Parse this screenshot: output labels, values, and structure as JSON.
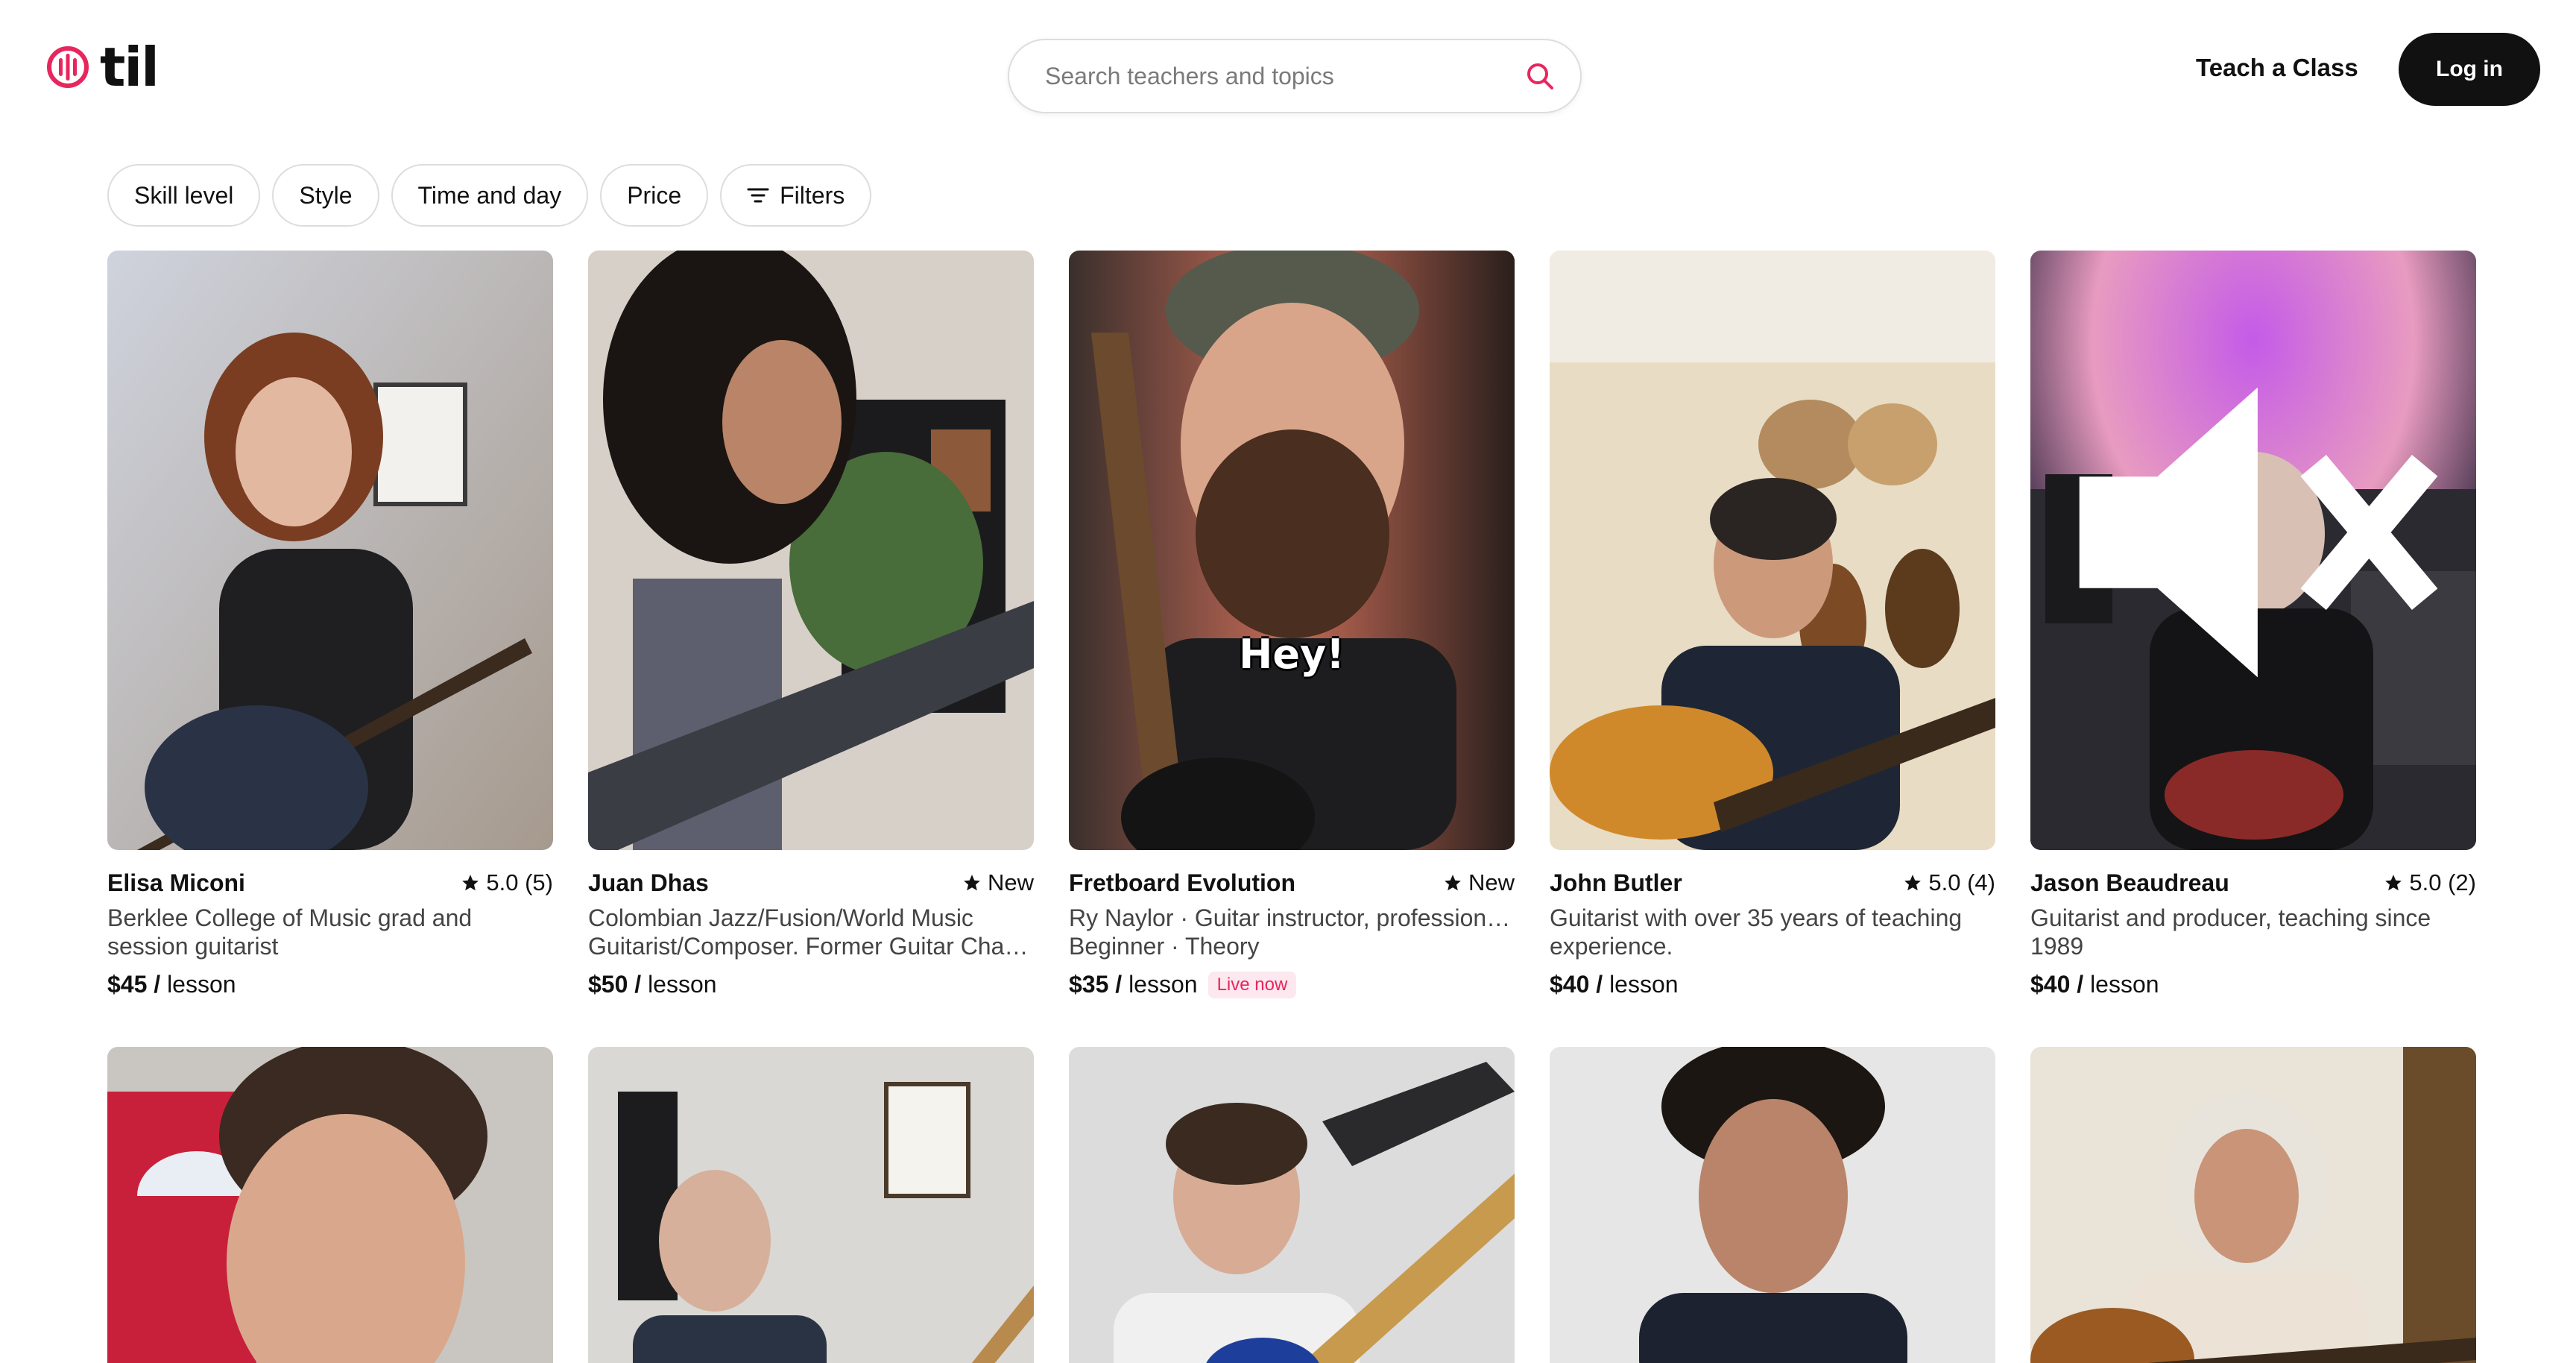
{
  "brand": {
    "name": "til",
    "accent": "#e8265e"
  },
  "search": {
    "placeholder": "Search teachers and topics",
    "icon": "search-icon"
  },
  "nav": {
    "teach_label": "Teach a Class",
    "login_label": "Log in"
  },
  "filters": [
    {
      "label": "Skill level"
    },
    {
      "label": "Style"
    },
    {
      "label": "Time and day"
    },
    {
      "label": "Price"
    },
    {
      "label": "Filters",
      "icon": "filters-icon"
    }
  ],
  "cards": [
    {
      "name": "Elisa Miconi",
      "rating": "5.0 (5)",
      "description": "Berklee College of Music grad and session guitarist",
      "price": "$45",
      "unit": "lesson"
    },
    {
      "name": "Juan Dhas",
      "rating": "New",
      "description": "Colombian Jazz/Fusion/World Music Guitarist/Composer. Former Guitar Cha…",
      "price": "$50",
      "unit": "lesson"
    },
    {
      "name": "Fretboard Evolution",
      "rating": "New",
      "description": "Ry Naylor · Guitar instructor, profession… Beginner · Theory",
      "price": "$35",
      "unit": "lesson",
      "badge": "Live now",
      "caption": "Hey!"
    },
    {
      "name": "John Butler",
      "rating": "5.0 (4)",
      "description": "Guitarist with over 35 years of teaching experience.",
      "price": "$40",
      "unit": "lesson"
    },
    {
      "name": "Jason Beaudreau",
      "rating": "5.0 (2)",
      "description": "Guitarist and producer, teaching since 1989",
      "price": "$40",
      "unit": "lesson",
      "icon": "mute-icon"
    }
  ]
}
